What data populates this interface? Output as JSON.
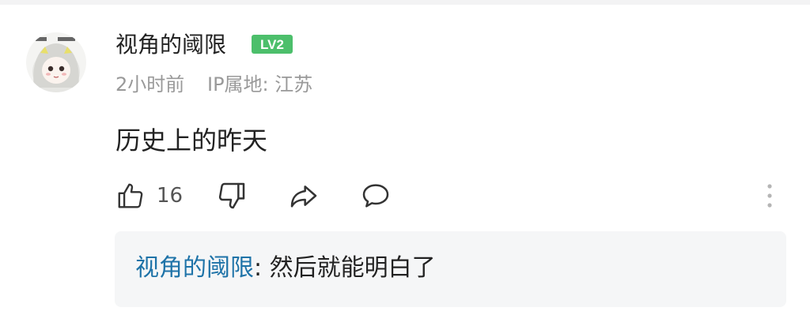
{
  "comment": {
    "author": "视角的阈限",
    "level": "LV2",
    "time": "2小时前",
    "ip_location": "IP属地: 江苏",
    "text": "历史上的昨天",
    "likes": "16"
  },
  "reply": {
    "author": "视角的阈限",
    "separator": ": ",
    "text": "然后就能明白了"
  },
  "colors": {
    "reply_author": "#1e73a8",
    "level_badge": "#4cbf6b",
    "meta_text": "#999999"
  }
}
